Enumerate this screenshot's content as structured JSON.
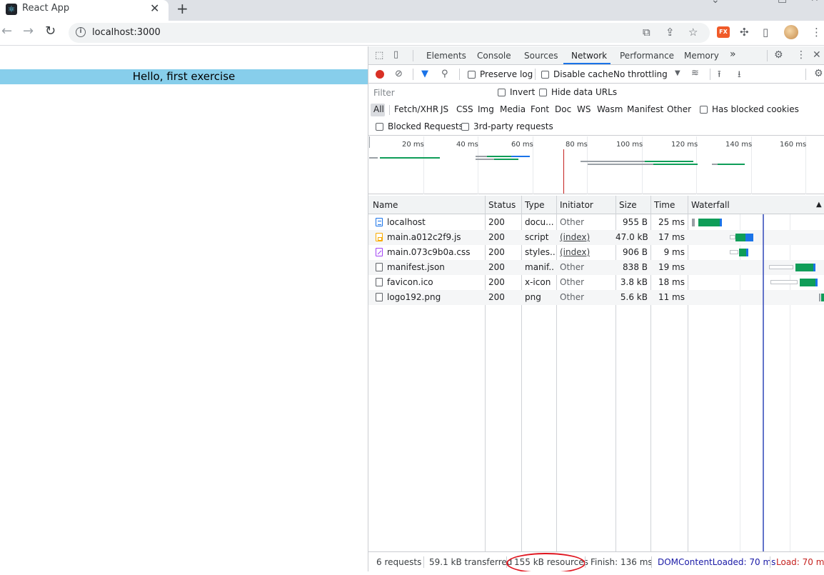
{
  "browser": {
    "tab_title": "React App",
    "tab_close": "✕",
    "new_tab": "+",
    "url": "localhost:3000",
    "icons": [
      "back-arrow-icon",
      "forward-arrow-icon",
      "reload-icon",
      "info-icon",
      "translate-icon",
      "share-icon",
      "star-icon",
      "extension-fx-icon",
      "puzzle-icon",
      "sidepanel-icon",
      "avatar",
      "kebab-menu-icon"
    ],
    "ext_label": "FX"
  },
  "page": {
    "hello_text": "Hello, first exercise",
    "hello_bg": "#87ceeb"
  },
  "devtools": {
    "tabs": [
      "Elements",
      "Console",
      "Sources",
      "Network",
      "Performance",
      "Memory"
    ],
    "active_tab": "Network",
    "more_tabs": "»",
    "toolbar": {
      "preserve_log": "Preserve log",
      "disable_cache": "Disable cache",
      "throttling": "No throttling"
    },
    "filter": {
      "placeholder": "Filter",
      "invert": "Invert",
      "hide_data_urls": "Hide data URLs"
    },
    "types": [
      "All",
      "Fetch/XHR",
      "JS",
      "CSS",
      "Img",
      "Media",
      "Font",
      "Doc",
      "WS",
      "Wasm",
      "Manifest",
      "Other"
    ],
    "has_blocked_cookies": "Has blocked cookies",
    "blocked_requests": "Blocked Requests",
    "third_party": "3rd-party requests",
    "overview_ticks": [
      "20 ms",
      "40 ms",
      "60 ms",
      "80 ms",
      "100 ms",
      "120 ms",
      "140 ms",
      "160 ms"
    ],
    "columns": [
      "Name",
      "Status",
      "Type",
      "Initiator",
      "Size",
      "Time",
      "Waterfall"
    ],
    "rows": [
      {
        "name": "localhost",
        "status": "200",
        "type": "docu...",
        "initiator": "Other",
        "size": "955 B",
        "time": "25 ms",
        "icon": "document-icon"
      },
      {
        "name": "main.a012c2f9.js",
        "status": "200",
        "type": "script",
        "initiator": "(index)",
        "size": "47.0 kB",
        "time": "17 ms",
        "icon": "script-icon"
      },
      {
        "name": "main.073c9b0a.css",
        "status": "200",
        "type": "styles...",
        "initiator": "(index)",
        "size": "906 B",
        "time": "9 ms",
        "icon": "stylesheet-icon"
      },
      {
        "name": "manifest.json",
        "status": "200",
        "type": "manif...",
        "initiator": "Other",
        "size": "838 B",
        "time": "19 ms",
        "icon": "file-icon"
      },
      {
        "name": "favicon.ico",
        "status": "200",
        "type": "x-icon",
        "initiator": "Other",
        "size": "3.8 kB",
        "time": "18 ms",
        "icon": "file-icon"
      },
      {
        "name": "logo192.png",
        "status": "200",
        "type": "png",
        "initiator": "Other",
        "size": "5.6 kB",
        "time": "11 ms",
        "icon": "file-icon"
      }
    ],
    "status_bar": {
      "requests": "6 requests",
      "transferred": "59.1 kB transferred",
      "resources": "155 kB resources",
      "finish": "Finish: 136 ms",
      "dcl": "DOMContentLoaded: 70 ms",
      "load": "Load: 70 ms",
      "dcl_color": "#1a1aa6",
      "load_color": "#c5221f"
    }
  }
}
